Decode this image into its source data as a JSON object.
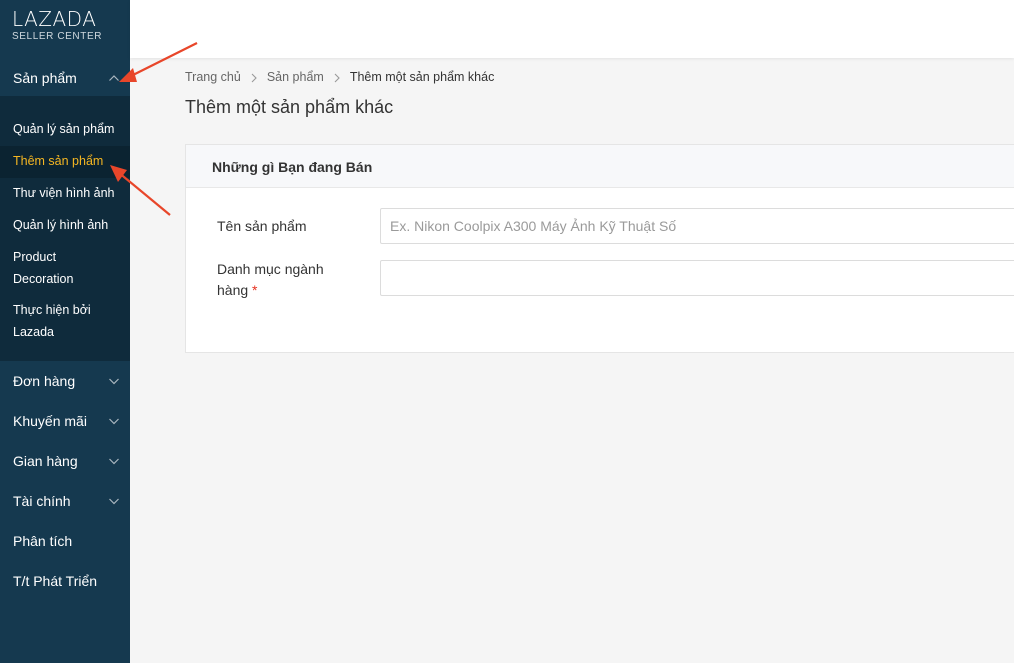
{
  "logo": {
    "main": "LAZADA",
    "sub": "SELLER CENTER"
  },
  "sidebar": {
    "expanded": {
      "label": "Sản phẩm",
      "icon": "chevron-up-icon",
      "submenu": [
        {
          "label": "Quản lý sản phẩm"
        },
        {
          "label": "Thêm sản phẩm",
          "active": true
        },
        {
          "label": "Thư viện hình ảnh"
        },
        {
          "label": "Quản lý hình ảnh"
        },
        {
          "label": "Product Decoration"
        },
        {
          "label": "Thực hiện bởi Lazada"
        }
      ]
    },
    "items": [
      {
        "label": "Đơn hàng",
        "icon": "chevron-down-icon"
      },
      {
        "label": "Khuyến mãi",
        "icon": "chevron-down-icon"
      },
      {
        "label": "Gian hàng",
        "icon": "chevron-down-icon"
      },
      {
        "label": "Tài chính",
        "icon": "chevron-down-icon"
      },
      {
        "label": "Phân tích"
      },
      {
        "label": "T/t Phát Triển"
      }
    ]
  },
  "breadcrumb": [
    "Trang chủ",
    "Sản phẩm",
    "Thêm một sản phẩm khác"
  ],
  "page": {
    "title": "Thêm một sản phẩm khác"
  },
  "form": {
    "section_title": "Những gì Bạn đang Bán",
    "product_name": {
      "label": "Tên sản phẩm",
      "placeholder": "Ex. Nikon Coolpix A300 Máy Ảnh Kỹ Thuật Số",
      "value": ""
    },
    "category": {
      "label_line1": "Danh mục ngành",
      "label_line2": "hàng",
      "required_mark": "*",
      "value": ""
    }
  },
  "colors": {
    "sidebar_bg": "#15394f",
    "submenu_bg": "#0f2b3c",
    "active_text": "#f5b622",
    "annotation_arrow": "#e8462a"
  }
}
